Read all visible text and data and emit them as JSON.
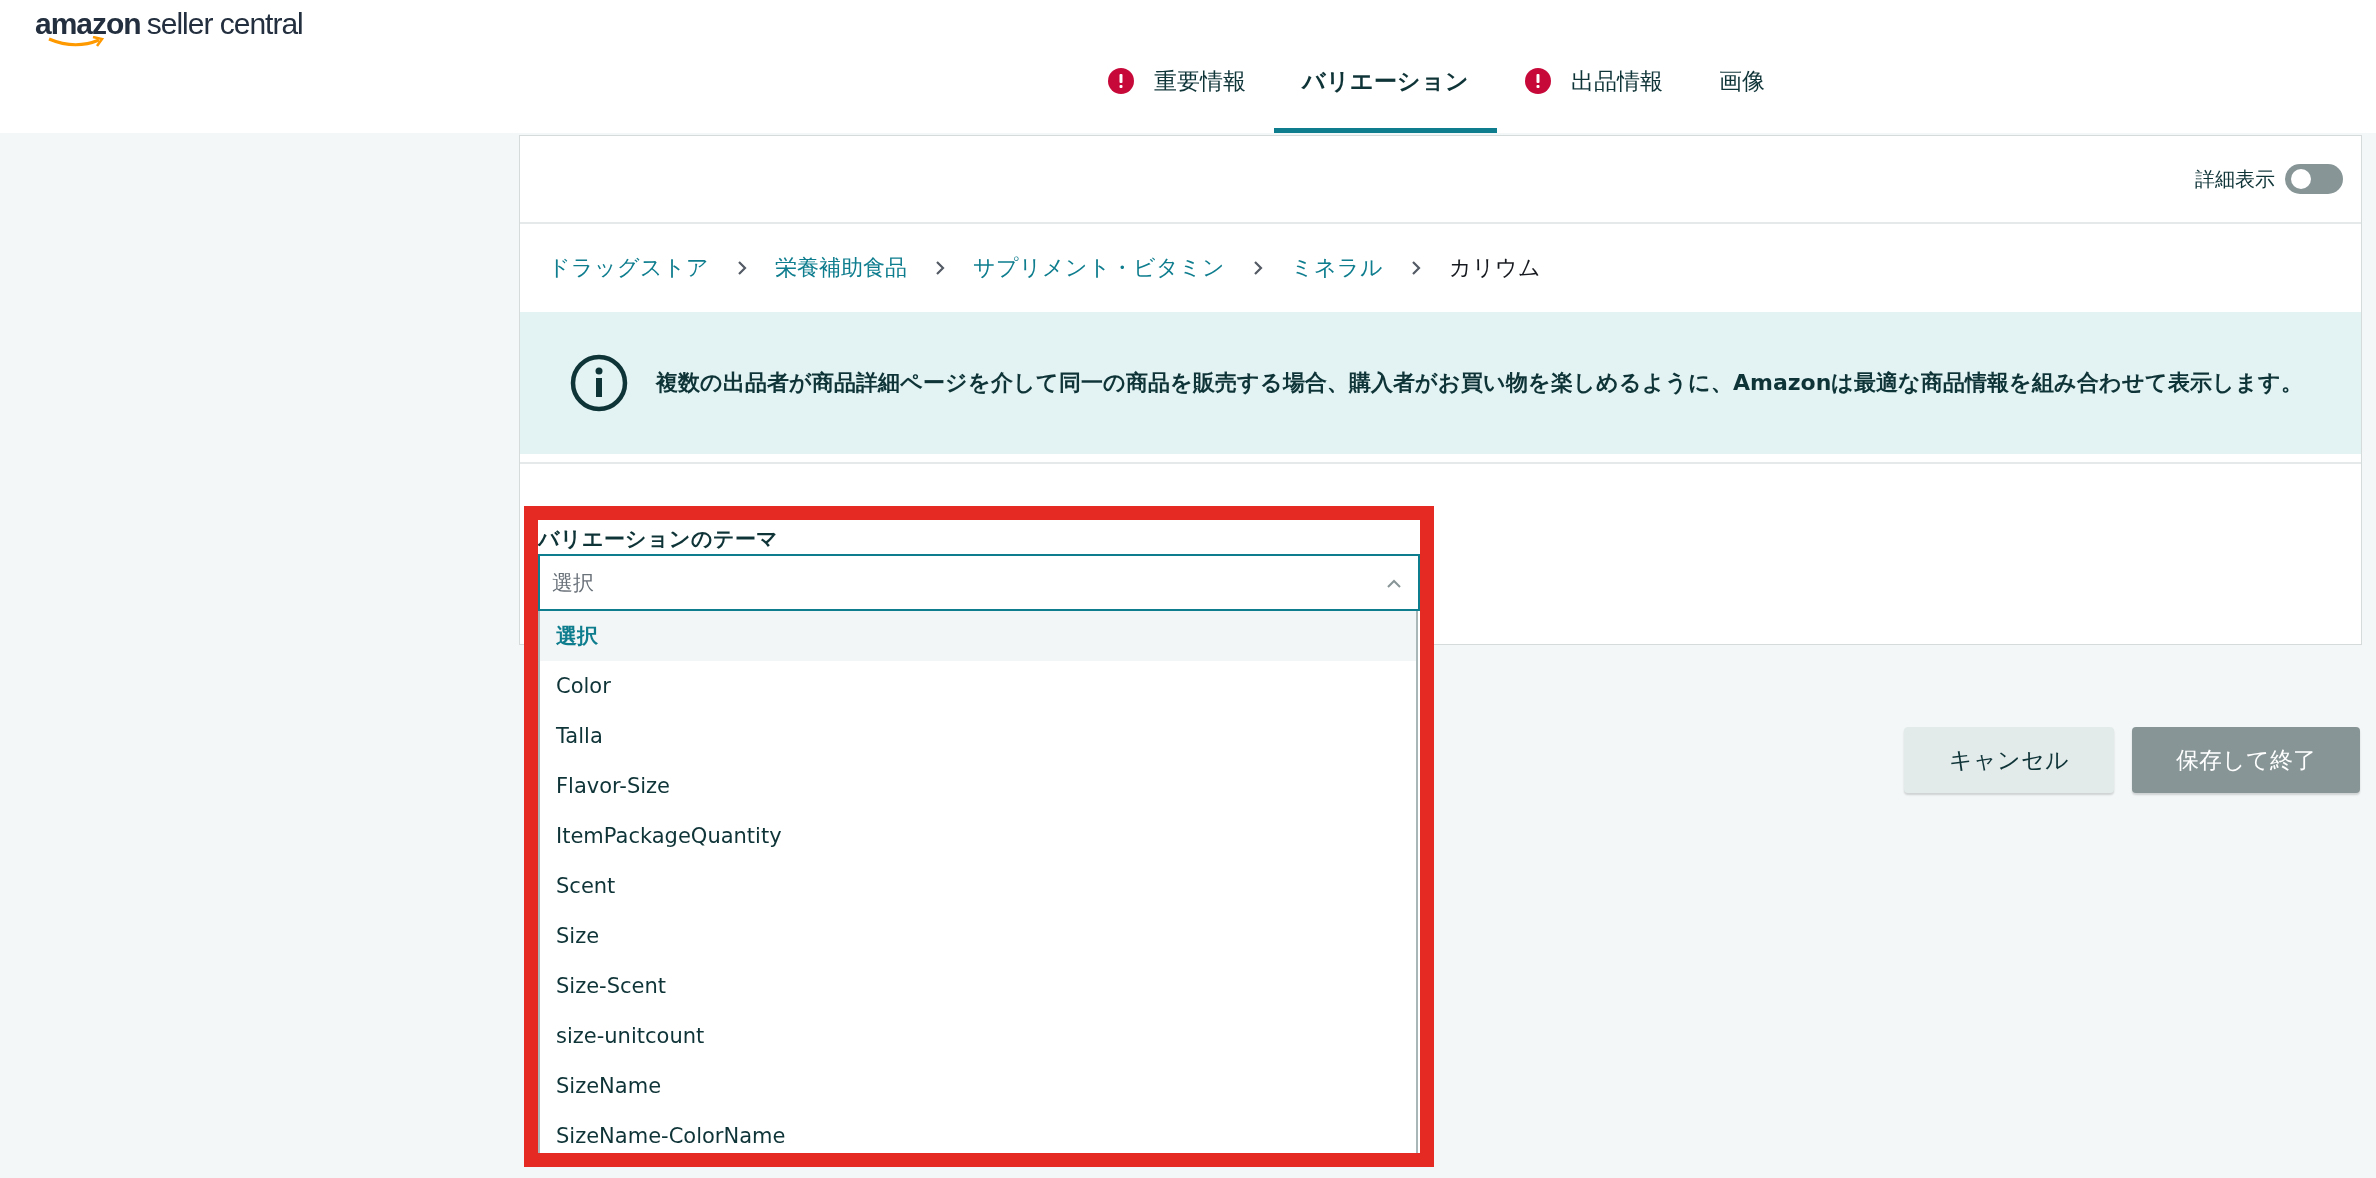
{
  "logo": {
    "brand": "amazon",
    "product": "seller central"
  },
  "tabs": [
    {
      "label": "重要情報",
      "alert": true,
      "selected": false
    },
    {
      "label": "バリエーション",
      "alert": false,
      "selected": true
    },
    {
      "label": "出品情報",
      "alert": true,
      "selected": false
    },
    {
      "label": "画像",
      "alert": false,
      "selected": false
    }
  ],
  "detail_toggle": {
    "label": "詳細表示",
    "on": false
  },
  "breadcrumb": [
    {
      "label": "ドラッグストア",
      "kind": "link"
    },
    {
      "label": "栄養補助食品",
      "kind": "link"
    },
    {
      "label": "サプリメント・ビタミン",
      "kind": "link"
    },
    {
      "label": "ミネラル",
      "kind": "link"
    },
    {
      "label": "カリウム",
      "kind": "current"
    }
  ],
  "info_banner": {
    "text": "複数の出品者が商品詳細ページを介して同一の商品を販売する場合、購入者がお買い物を楽しめるように、Amazonは最適な商品情報を組み合わせて表示します。"
  },
  "variation_theme": {
    "label": "バリエーションのテーマ",
    "placeholder": "選択",
    "expanded": true,
    "options": [
      {
        "label": "選択",
        "selected": true
      },
      {
        "label": "Color",
        "selected": false
      },
      {
        "label": "Talla",
        "selected": false
      },
      {
        "label": "Flavor-Size",
        "selected": false
      },
      {
        "label": "ItemPackageQuantity",
        "selected": false
      },
      {
        "label": "Scent",
        "selected": false
      },
      {
        "label": "Size",
        "selected": false
      },
      {
        "label": "Size-Scent",
        "selected": false
      },
      {
        "label": "size-unitcount",
        "selected": false
      },
      {
        "label": "SizeName",
        "selected": false
      },
      {
        "label": "SizeName-ColorName",
        "selected": false
      }
    ]
  },
  "buttons": [
    {
      "label": "キャンセル",
      "kind": "secondary",
      "disabled": false
    },
    {
      "label": "保存して終了",
      "kind": "primary",
      "disabled": true
    }
  ]
}
